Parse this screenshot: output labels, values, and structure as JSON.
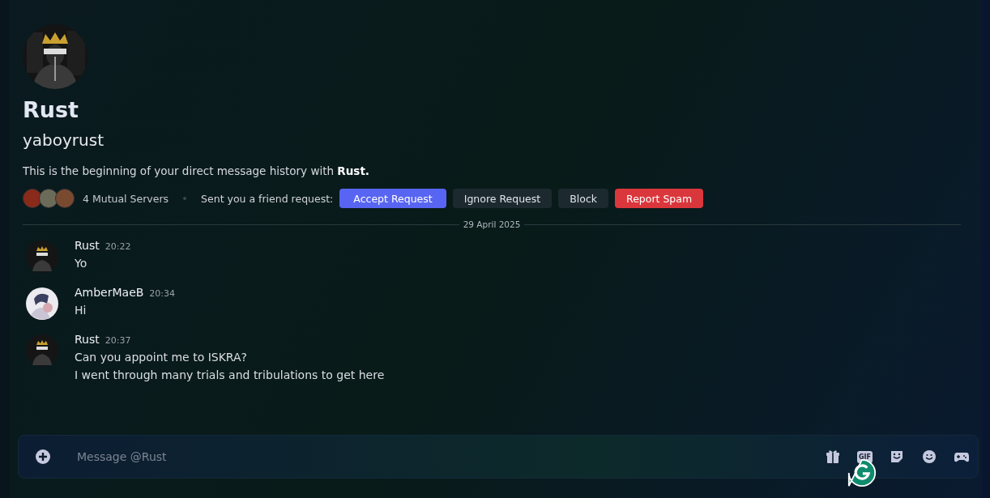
{
  "profile": {
    "display_name": "Rust",
    "username": "yaboyrust",
    "intro": "This is the beginning of your direct message history with **Rust.**"
  },
  "mutual": {
    "server_icons": [
      {
        "color": "#8a2a1a"
      },
      {
        "color": "#6b6b5a"
      },
      {
        "color": "#7a4a30"
      }
    ],
    "label": "4 Mutual Servers"
  },
  "friend_request": {
    "label": "Sent you a friend request:",
    "buttons": [
      {
        "label": "Accept Request",
        "kind": "primary"
      },
      {
        "label": "Ignore Request",
        "kind": "secondary"
      },
      {
        "label": "Block",
        "kind": "secondary"
      },
      {
        "label": "Report Spam",
        "kind": "danger"
      }
    ]
  },
  "date_divider": "29 April 2025",
  "messages": [
    {
      "author": "Rust",
      "time": "20:22",
      "color": "#151515",
      "lines": [
        "Yo"
      ]
    },
    {
      "author": "AmberMaeB",
      "time": "20:34",
      "color": "#ecebf0",
      "lines": [
        "Hi"
      ]
    },
    {
      "author": "Rust",
      "time": "20:37",
      "color": "#151515",
      "lines": [
        "Can you appoint me to ISKRA?",
        "I went through many trials and tribulations to get here"
      ]
    }
  ],
  "composer": {
    "placeholder": "Message @Rust",
    "gif_label": "GIF"
  }
}
